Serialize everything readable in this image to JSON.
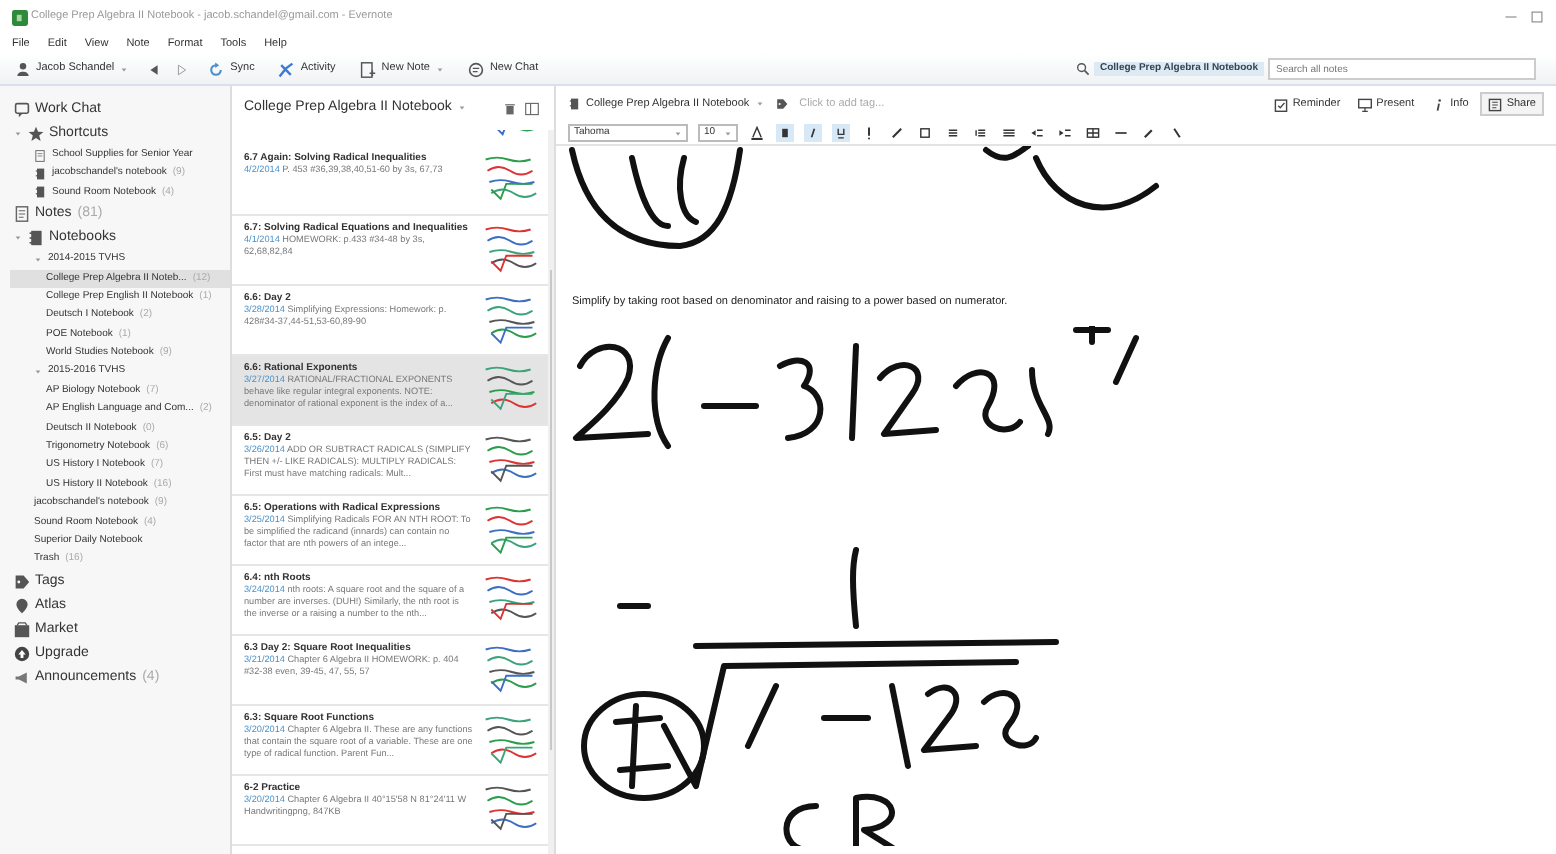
{
  "window": {
    "title": "College Prep Algebra II Notebook - jacob.schandel@gmail.com - Evernote"
  },
  "menu": [
    "File",
    "Edit",
    "View",
    "Note",
    "Format",
    "Tools",
    "Help"
  ],
  "toolbar": {
    "account": "Jacob Schandel",
    "buttons": [
      {
        "kind": "sync",
        "label": "Sync"
      },
      {
        "kind": "activity",
        "label": "Activity"
      },
      {
        "kind": "new-note",
        "label": "New Note"
      },
      {
        "kind": "new-chat",
        "label": "New Chat"
      }
    ]
  },
  "search": {
    "scope": "College Prep Algebra II Notebook",
    "placeholder": "Search all notes"
  },
  "sidebar": [
    {
      "kind": "chat",
      "label": "Work Chat"
    },
    {
      "kind": "star",
      "label": "Shortcuts",
      "expanded": true,
      "children": [
        {
          "kind": "note",
          "label": "School Supplies for Senior Year"
        },
        {
          "kind": "notebook",
          "label": "jacobschandel's notebook",
          "count": "(9)"
        },
        {
          "kind": "notebook",
          "label": "Sound Room Notebook",
          "count": "(4)"
        }
      ]
    },
    {
      "kind": "notes",
      "label": "Notes",
      "count": "(81)"
    },
    {
      "kind": "notebooks",
      "label": "Notebooks",
      "expanded": true,
      "children": [
        {
          "label": "2014-2015 TVHS",
          "expanded": true,
          "children": [
            {
              "label": "College Prep Algebra II Noteb...",
              "count": "(12)",
              "selected": true
            },
            {
              "label": "College Prep English II Notebook",
              "count": "(1)",
              "selected": false
            },
            {
              "label": "Deutsch I Notebook",
              "count": "(2)",
              "selected": false
            },
            {
              "label": "POE Notebook",
              "count": "(1)",
              "selected": false
            },
            {
              "label": "World Studies Notebook",
              "count": "(9)",
              "selected": false
            }
          ]
        },
        {
          "label": "2015-2016 TVHS",
          "expanded": true,
          "children": [
            {
              "label": "AP Biology Notebook",
              "count": "(7)",
              "selected": false
            },
            {
              "label": "AP English Language and Com...",
              "count": "(2)",
              "selected": false
            },
            {
              "label": "Deutsch II Notebook",
              "count": "(0)",
              "selected": false
            },
            {
              "label": "Trigonometry Notebook",
              "count": "(6)",
              "selected": false
            },
            {
              "label": "US History I Notebook",
              "count": "(7)",
              "selected": false
            },
            {
              "label": "US History II Notebook",
              "count": "(16)",
              "selected": false
            }
          ]
        },
        {
          "label": "jacobschandel's notebook",
          "count": "(9)",
          "selected": false
        },
        {
          "label": "Sound Room Notebook",
          "count": "(4)",
          "selected": false
        },
        {
          "label": "Superior Daily Notebook",
          "selected": false
        },
        {
          "label": "Trash",
          "count": "(16)",
          "selected": false
        }
      ]
    },
    {
      "kind": "tag",
      "label": "Tags"
    },
    {
      "kind": "pin",
      "label": "Atlas"
    },
    {
      "kind": "market",
      "label": "Market"
    },
    {
      "kind": "upgrade",
      "label": "Upgrade"
    },
    {
      "kind": "megaphone",
      "label": "Announcements",
      "count": "(4)"
    }
  ],
  "note_list": {
    "title": "College Prep Algebra II Notebook",
    "notes": [
      {
        "title": "6.7 Again: Solving Radical Inequalities",
        "date": "4/2/2014",
        "snippet": "P. 453 #36,39,38,40,51-60 by 3s, 67,73",
        "selected": false
      },
      {
        "title": "6.7: Solving Radical Equations and Inequalities",
        "date": "4/1/2014",
        "snippet": "HOMEWORK: p.433 #34-48 by 3s, 62,68,82,84",
        "selected": false
      },
      {
        "title": "6.6: Day 2",
        "date": "3/28/2014",
        "snippet": "Simplifying Expressions: Homework: p. 428#34-37,44-51,53-60,89-90",
        "selected": false
      },
      {
        "title": "6.6: Rational Exponents",
        "date": "3/27/2014",
        "snippet": "RATIONAL/FRACTIONAL EXPONENTS behave like regular integral exponents. NOTE: denominator of rational exponent is the index of a...",
        "selected": true
      },
      {
        "title": "6.5: Day 2",
        "date": "3/26/2014",
        "snippet": "ADD OR SUBTRACT RADICALS (SIMPLIFY THEN +/- LIKE RADICALS): MULTIPLY RADICALS: First must have matching radicals: Mult...",
        "selected": false
      },
      {
        "title": "6.5: Operations with Radical Expressions",
        "date": "3/25/2014",
        "snippet": "Simplifying Radicals FOR AN NTH ROOT: To be simplified the radicand (innards) can contain no factor that are nth powers of an intege...",
        "selected": false
      },
      {
        "title": "6.4: nth Roots",
        "date": "3/24/2014",
        "snippet": "nth roots: A square root and the square of a number are inverses. (DUH!) Similarly, the nth root is the inverse or a raising a number to the nth...",
        "selected": false
      },
      {
        "title": "6.3 Day 2: Square Root Inequalities",
        "date": "3/21/2014",
        "snippet": "Chapter 6 Algebra II HOMEWORK: p. 404 #32-38 even, 39-45, 47, 55, 57",
        "selected": false
      },
      {
        "title": "6.3: Square Root Functions",
        "date": "3/20/2014",
        "snippet": "Chapter 6 Algebra II. These are any functions that contain the square root of a variable. These are one type of radical function. Parent Fun...",
        "selected": false
      },
      {
        "title": "6-2 Practice",
        "date": "3/20/2014",
        "snippet": "Chapter 6 Algebra II 40°15'58 N 81°24'11 W Handwritingpng, 847KB",
        "selected": false
      }
    ]
  },
  "editor": {
    "notebook": "College Prep Algebra II Notebook",
    "tag_placeholder": "Click to add tag...",
    "actions": [
      {
        "kind": "reminder",
        "label": "Reminder"
      },
      {
        "kind": "present",
        "label": "Present"
      },
      {
        "kind": "info",
        "label": "Info"
      },
      {
        "kind": "share",
        "label": "Share"
      }
    ],
    "font": "Tahoma",
    "font_size": "10",
    "body": "Simplify by taking root based on denominator and raising to a power based on numerator."
  }
}
